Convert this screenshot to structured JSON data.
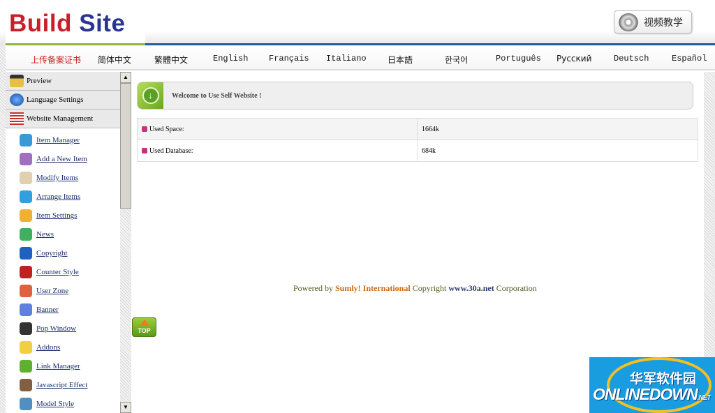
{
  "header": {
    "logo_part1": "Build",
    "logo_part2": "Site",
    "video_button": "视频教学"
  },
  "languages": [
    "上传备案证书",
    "简体中文",
    "繁體中文",
    "English",
    "Français",
    "Italiano",
    "日本語",
    "한국어",
    "Português",
    "Русский",
    "Deutsch",
    "Español"
  ],
  "sidebar": {
    "sections": [
      "Preview",
      "Language Settings",
      "Website Management"
    ],
    "items": [
      "Item Manager",
      "Add a New Item",
      "Modify Items",
      "Arrange Items",
      "Item Settings",
      "News",
      "Copyright",
      "Counter Style",
      "User Zone",
      "Banner",
      "Pop Window",
      "Addons",
      "Link Manager",
      "Javascript Effect",
      "Model Style"
    ]
  },
  "main": {
    "welcome": "Welcome to Use Self Website !",
    "stats": [
      {
        "label": "Used Space:",
        "value": "1664k"
      },
      {
        "label": "Used Database:",
        "value": "684k"
      }
    ],
    "footer": {
      "prefix": "Powered by",
      "company": "Sumly! International",
      "middle": "Copyright",
      "site": "www.30a.net",
      "suffix": "Corporation"
    },
    "top_button": "TOP"
  },
  "watermark": {
    "cn": "华军软件园",
    "en": "ONLINEDOWN",
    "tld": ".NET"
  },
  "colors": {
    "logo_red": "#c8202a",
    "logo_blue": "#2a3591",
    "accent_green": "#8cb33c",
    "accent_blue": "#24589a"
  }
}
